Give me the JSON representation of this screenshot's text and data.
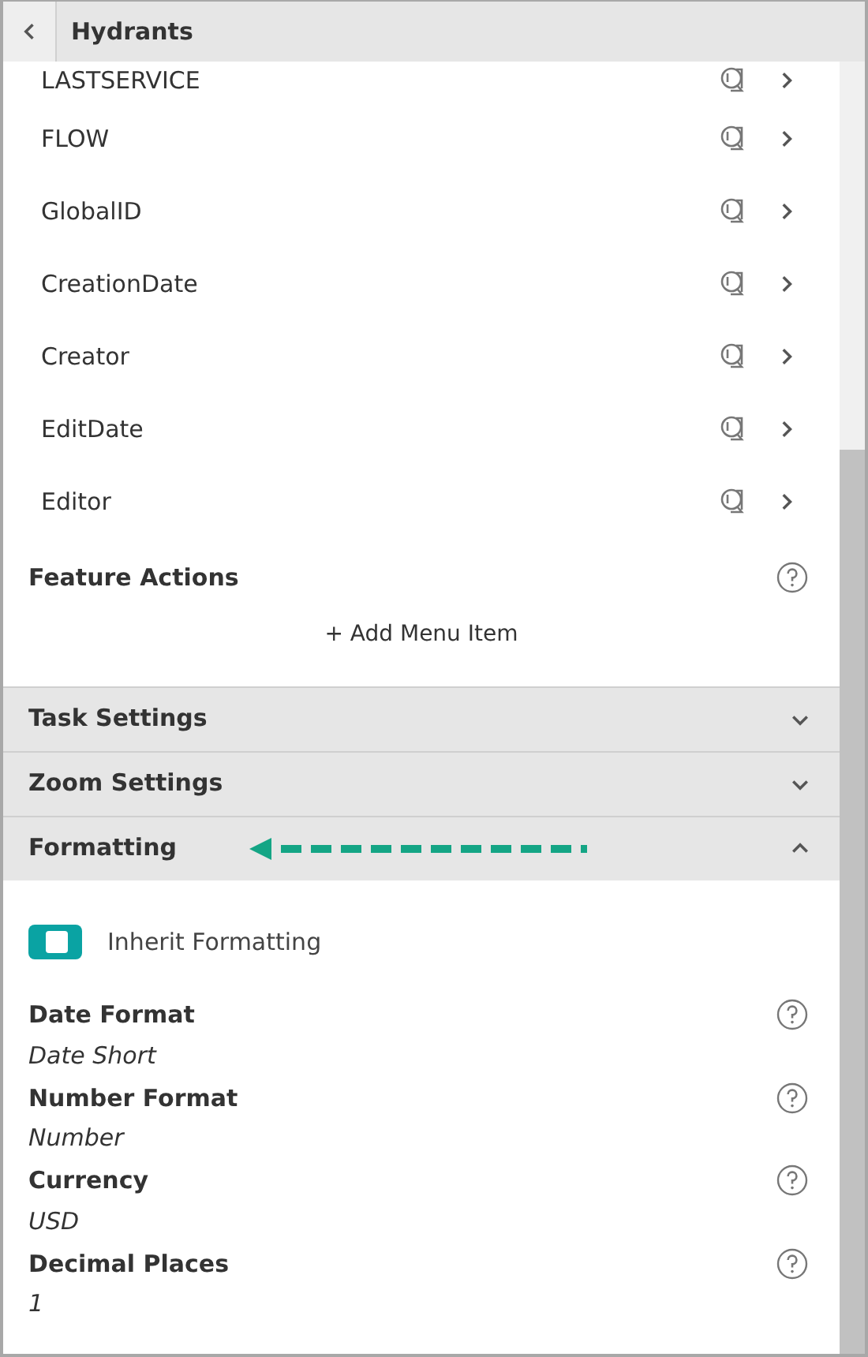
{
  "header": {
    "title": "Hydrants"
  },
  "fields": [
    {
      "name": "LASTSERVICE"
    },
    {
      "name": "FLOW"
    },
    {
      "name": "GlobalID"
    },
    {
      "name": "CreationDate"
    },
    {
      "name": "Creator"
    },
    {
      "name": "EditDate"
    },
    {
      "name": "Editor"
    }
  ],
  "feature_actions": {
    "title": "Feature Actions",
    "add_label": "+ Add Menu Item"
  },
  "sections": [
    {
      "title": "Task Settings",
      "expanded": false
    },
    {
      "title": "Zoom Settings",
      "expanded": false
    },
    {
      "title": "Formatting",
      "expanded": true
    }
  ],
  "formatting": {
    "toggle": {
      "label": "Inherit Formatting",
      "on": true
    },
    "settings": [
      {
        "label": "Date Format",
        "value": "Date Short"
      },
      {
        "label": "Number Format",
        "value": "Number"
      },
      {
        "label": "Currency",
        "value": "USD"
      },
      {
        "label": "Decimal Places",
        "value": "1"
      }
    ]
  }
}
